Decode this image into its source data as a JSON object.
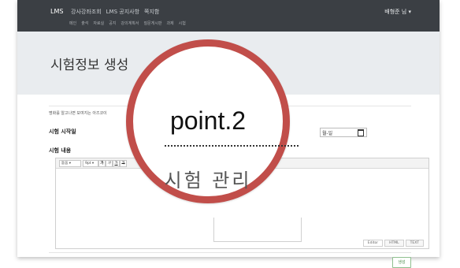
{
  "navbar": {
    "brand": "LMS",
    "items": [
      "강사강좌조회",
      "LMS 공지사항",
      "쪽지함"
    ],
    "subitems": [
      "메인",
      "출석",
      "자료실",
      "공지",
      "강의계획서",
      "질문게시판",
      "과제",
      "시험"
    ],
    "user": "배형준 님 ▾"
  },
  "page": {
    "title": "시험정보 생성"
  },
  "form": {
    "notice": "명화를 알고나면 보여지는 아즈코이",
    "start_label": "시험 시작일",
    "date_placeholder": "월-일",
    "content_label": "시험 내용",
    "toolbar": {
      "font_select": "돋움",
      "size_select": "9pt",
      "bold": "가",
      "italic": "가",
      "underline": "가",
      "strike": "가"
    },
    "modes": [
      "Editor",
      "HTML",
      "TEXT"
    ],
    "submit": "생성"
  },
  "overlay": {
    "heading": "point.2",
    "subheading": "시험 관리"
  },
  "colors": {
    "navbar": "#3b3f44",
    "jumbotron": "#e9ecef",
    "accent_ring": "#c14e4a"
  }
}
